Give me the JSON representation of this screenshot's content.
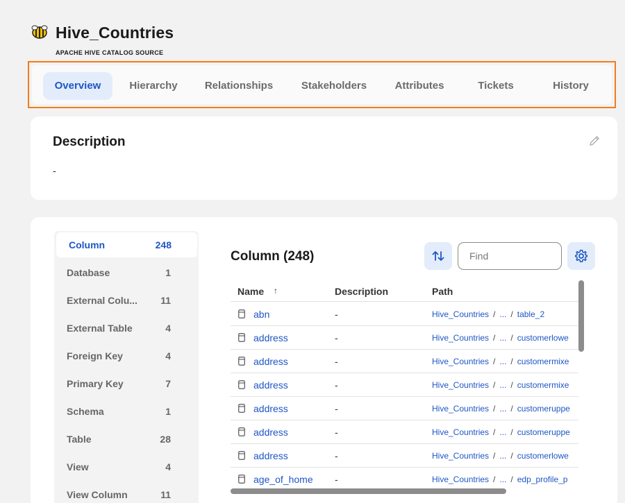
{
  "header": {
    "title": "Hive_Countries",
    "subtitle": "APACHE HIVE CATALOG SOURCE",
    "logo_icon": "hive-bee-icon"
  },
  "tabs": [
    {
      "label": "Overview",
      "active": true
    },
    {
      "label": "Hierarchy"
    },
    {
      "label": "Relationships"
    },
    {
      "label": "Stakeholders"
    },
    {
      "label": "Attributes"
    },
    {
      "label": "Tickets"
    },
    {
      "label": "History"
    }
  ],
  "description": {
    "title": "Description",
    "value": "-",
    "edit_icon": "pencil-icon"
  },
  "asset_types": [
    {
      "label": "Column",
      "count": "248",
      "active": true
    },
    {
      "label": "Database",
      "count": "1"
    },
    {
      "label": "External Colu...",
      "count": "11"
    },
    {
      "label": "External Table",
      "count": "4"
    },
    {
      "label": "Foreign Key",
      "count": "4"
    },
    {
      "label": "Primary Key",
      "count": "7"
    },
    {
      "label": "Schema",
      "count": "1"
    },
    {
      "label": "Table",
      "count": "28"
    },
    {
      "label": "View",
      "count": "4"
    },
    {
      "label": "View Column",
      "count": "11"
    }
  ],
  "columns_panel": {
    "title": "Column (248)",
    "find_placeholder": "Find",
    "sort_icon": "sort-arrows-icon",
    "settings_icon": "gear-icon",
    "headers": {
      "name": "Name",
      "name_sort": "↑",
      "description": "Description",
      "path": "Path"
    },
    "rows": [
      {
        "name": "abn",
        "description": "-",
        "path_root": "Hive_Countries",
        "path_mid": "...",
        "path_leaf": "table_2"
      },
      {
        "name": "address",
        "description": "-",
        "path_root": "Hive_Countries",
        "path_mid": "...",
        "path_leaf": "customerlowe"
      },
      {
        "name": "address",
        "description": "-",
        "path_root": "Hive_Countries",
        "path_mid": "...",
        "path_leaf": "customermixe"
      },
      {
        "name": "address",
        "description": "-",
        "path_root": "Hive_Countries",
        "path_mid": "...",
        "path_leaf": "customermixe"
      },
      {
        "name": "address",
        "description": "-",
        "path_root": "Hive_Countries",
        "path_mid": "...",
        "path_leaf": "customeruppe"
      },
      {
        "name": "address",
        "description": "-",
        "path_root": "Hive_Countries",
        "path_mid": "...",
        "path_leaf": "customeruppe"
      },
      {
        "name": "address",
        "description": "-",
        "path_root": "Hive_Countries",
        "path_mid": "...",
        "path_leaf": "customerlowe"
      },
      {
        "name": "age_of_home",
        "description": "-",
        "path_root": "Hive_Countries",
        "path_mid": "...",
        "path_leaf": "edp_profile_p"
      }
    ]
  },
  "colors": {
    "accent": "#1e56c4",
    "highlight_border": "#f07d1a",
    "active_tab_bg": "#e3ecfa"
  }
}
